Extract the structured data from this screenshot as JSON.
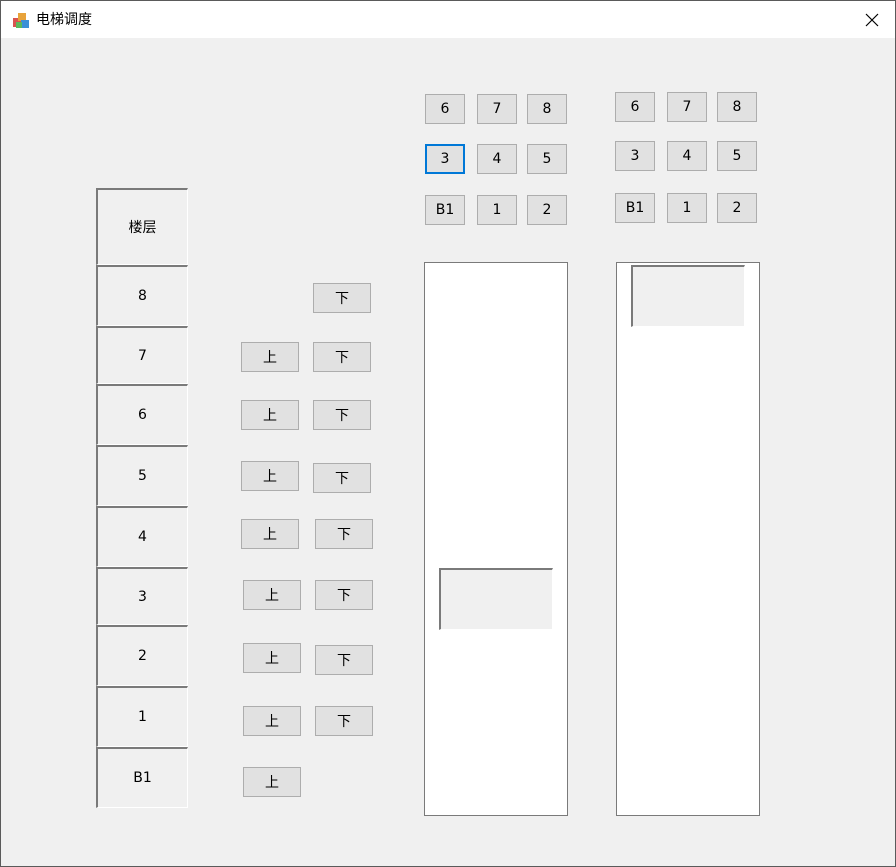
{
  "window": {
    "title": "电梯调度"
  },
  "floors": {
    "header": "楼层",
    "labels": [
      "8",
      "7",
      "6",
      "5",
      "4",
      "3",
      "2",
      "1",
      "B1"
    ]
  },
  "call_buttons": {
    "up": "上",
    "down": "下"
  },
  "elevator1": {
    "rows": [
      [
        "6",
        "7",
        "8"
      ],
      [
        "3",
        "4",
        "5"
      ],
      [
        "B1",
        "1",
        "2"
      ]
    ],
    "focused": "3"
  },
  "elevator2": {
    "rows": [
      [
        "6",
        "7",
        "8"
      ],
      [
        "3",
        "4",
        "5"
      ],
      [
        "B1",
        "1",
        "2"
      ]
    ]
  }
}
